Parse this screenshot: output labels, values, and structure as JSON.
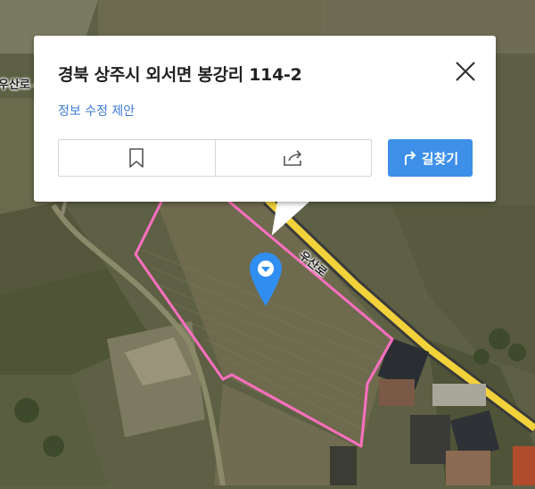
{
  "popup": {
    "address": "경북 상주시 외서면 봉강리 114-2",
    "edit_link": "정보 수정 제안",
    "route_button": "길찾기"
  },
  "map": {
    "road_labels": [
      "우산로",
      "우산로"
    ]
  },
  "colors": {
    "accent": "#3d8fe8",
    "link": "#3d7bd6",
    "parcel_outline": "#ff6fbf",
    "road": "#f2d23a"
  },
  "icons": {
    "close": "close-icon",
    "bookmark": "bookmark-icon",
    "share": "share-icon",
    "route": "route-arrow-icon",
    "pin": "location-pin-icon"
  }
}
